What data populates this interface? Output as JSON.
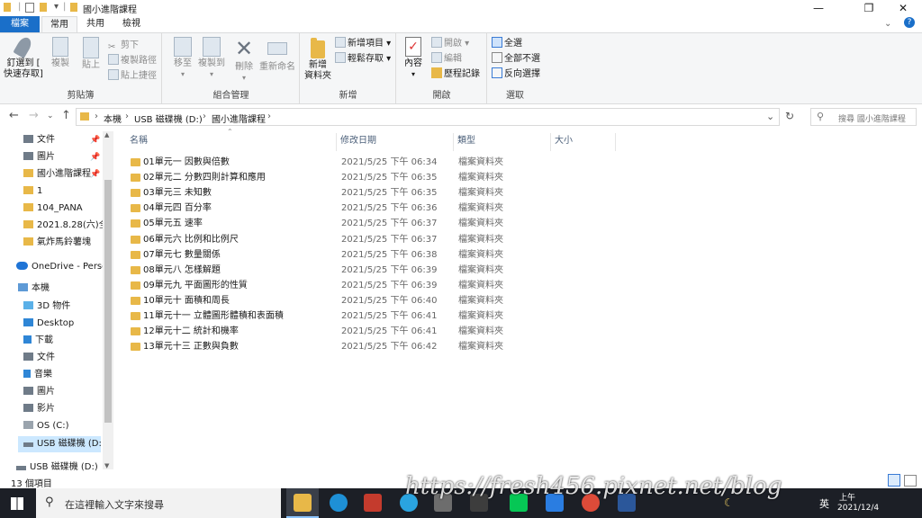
{
  "window": {
    "title": "國小進階課程",
    "controls": {
      "minimize": "—",
      "maximize": "❐",
      "close": "✕"
    }
  },
  "ribbon_tabs": [
    {
      "label": "檔案"
    },
    {
      "label": "常用"
    },
    {
      "label": "共用"
    },
    {
      "label": "檢視"
    }
  ],
  "ribbon": {
    "clipboard": {
      "group_label": "剪貼簿",
      "pin_label_1": "釘選到 [",
      "pin_label_2": "快速存取]",
      "copy": "複製",
      "paste": "貼上",
      "cut": "剪下",
      "copy_path": "複製路徑",
      "paste_shortcut": "貼上捷徑"
    },
    "organize": {
      "group_label": "組合管理",
      "move_to": "移至",
      "copy_to": "複製到",
      "delete": "刪除",
      "rename": "重新命名"
    },
    "new": {
      "group_label": "新增",
      "new_folder_1": "新增",
      "new_folder_2": "資料夾",
      "new_item": "新增項目 ▾",
      "easy_access": "輕鬆存取 ▾"
    },
    "open": {
      "group_label": "開啟",
      "properties": "內容",
      "open": "開啟 ▾",
      "edit": "編輯",
      "history": "歷程記錄"
    },
    "select": {
      "group_label": "選取",
      "select_all": "全選",
      "select_none": "全部不選",
      "invert": "反向選擇"
    }
  },
  "address": {
    "path": [
      "本機",
      "USB 磁碟機 (D:)",
      "國小進階課程"
    ],
    "search_placeholder": "搜尋 國小進階課程"
  },
  "nav_pane": {
    "quick_access": [
      {
        "label": "文件",
        "pinned": true
      },
      {
        "label": "圖片",
        "pinned": true
      },
      {
        "label": "國小進階課程",
        "pinned": true
      },
      {
        "label": "1",
        "pinned": false
      },
      {
        "label": "104_PANA",
        "pinned": false
      },
      {
        "label": "2021.8.28(六)全",
        "pinned": false
      },
      {
        "label": "氣炸馬鈴薯塊",
        "pinned": false
      }
    ],
    "onedrive": "OneDrive - Perso",
    "this_pc": "本機",
    "this_pc_items": [
      {
        "label": "3D 物件"
      },
      {
        "label": "Desktop"
      },
      {
        "label": "下載"
      },
      {
        "label": "文件"
      },
      {
        "label": "音樂"
      },
      {
        "label": "圖片"
      },
      {
        "label": "影片"
      },
      {
        "label": "OS (C:)"
      },
      {
        "label": "USB 磁碟機 (D:)"
      }
    ],
    "usb_root": "USB 磁碟機 (D:)"
  },
  "columns": {
    "name": "名稱",
    "date": "修改日期",
    "type": "類型",
    "size": "大小"
  },
  "files": [
    {
      "name": "01單元一 因數與倍數",
      "date": "2021/5/25 下午 06:34",
      "type": "檔案資料夾"
    },
    {
      "name": "02單元二 分數四則計算和應用",
      "date": "2021/5/25 下午 06:35",
      "type": "檔案資料夾"
    },
    {
      "name": "03單元三 未知數",
      "date": "2021/5/25 下午 06:35",
      "type": "檔案資料夾"
    },
    {
      "name": "04單元四 百分率",
      "date": "2021/5/25 下午 06:36",
      "type": "檔案資料夾"
    },
    {
      "name": "05單元五 速率",
      "date": "2021/5/25 下午 06:37",
      "type": "檔案資料夾"
    },
    {
      "name": "06單元六 比例和比例尺",
      "date": "2021/5/25 下午 06:37",
      "type": "檔案資料夾"
    },
    {
      "name": "07單元七 數量關係",
      "date": "2021/5/25 下午 06:38",
      "type": "檔案資料夾"
    },
    {
      "name": "08單元八 怎樣解題",
      "date": "2021/5/25 下午 06:39",
      "type": "檔案資料夾"
    },
    {
      "name": "09單元九 平面圖形的性質",
      "date": "2021/5/25 下午 06:39",
      "type": "檔案資料夾"
    },
    {
      "name": "10單元十 面積和周長",
      "date": "2021/5/25 下午 06:40",
      "type": "檔案資料夾"
    },
    {
      "name": "11單元十一 立體圖形體積和表面積",
      "date": "2021/5/25 下午 06:41",
      "type": "檔案資料夾"
    },
    {
      "name": "12單元十二 統計和機率",
      "date": "2021/5/25 下午 06:41",
      "type": "檔案資料夾"
    },
    {
      "name": "13單元十三 正數與負數",
      "date": "2021/5/25 下午 06:42",
      "type": "檔案資料夾"
    }
  ],
  "status": {
    "item_count": "13 個項目"
  },
  "taskbar": {
    "search_placeholder": "在這裡輸入文字來搜尋",
    "lang": "英",
    "time": "上午",
    "date": "2021/12/4"
  },
  "watermark": "https://fresh456.pixnet.net/blog"
}
